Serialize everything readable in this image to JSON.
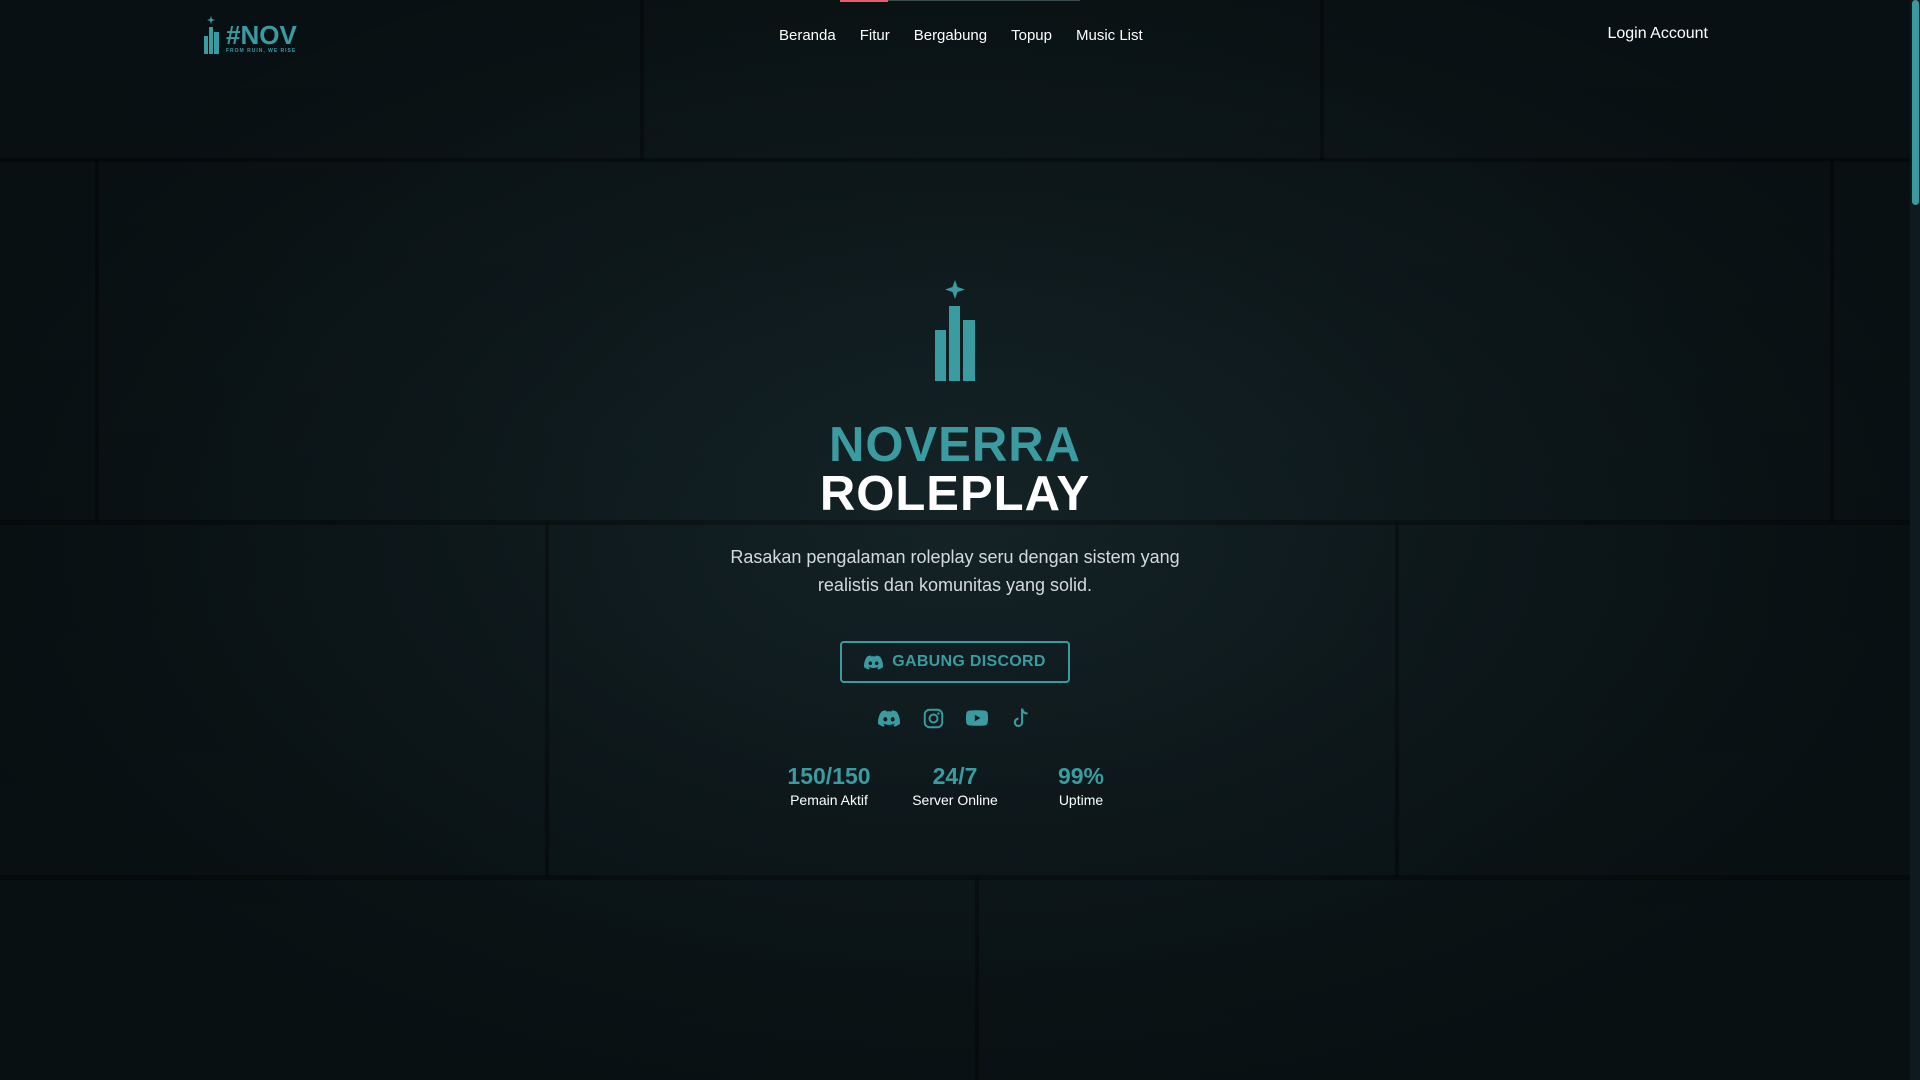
{
  "colors": {
    "accent": "#3a9ba1",
    "background": "#0b1417",
    "text": "#ffffff"
  },
  "header": {
    "logo": {
      "text": "#NOV",
      "tagline": "FROM RUIN, WE RISE",
      "icon": "building-star-icon"
    },
    "nav": [
      {
        "label": "Beranda"
      },
      {
        "label": "Fitur"
      },
      {
        "label": "Bergabung"
      },
      {
        "label": "Topup"
      },
      {
        "label": "Music List"
      }
    ],
    "login_label": "Login Account"
  },
  "hero": {
    "icon": "building-star-icon",
    "title_line1": "NOVERRA",
    "title_line2": "ROLEPLAY",
    "description": "Rasakan pengalaman roleplay seru dengan sistem yang realistis dan komunitas yang solid.",
    "cta": {
      "label": "GABUNG DISCORD",
      "icon": "discord-icon"
    },
    "socials": [
      {
        "icon": "discord-icon"
      },
      {
        "icon": "instagram-icon"
      },
      {
        "icon": "youtube-icon"
      },
      {
        "icon": "tiktok-icon"
      }
    ],
    "stats": [
      {
        "value": "150/150",
        "label": "Pemain Aktif"
      },
      {
        "value": "24/7",
        "label": "Server Online"
      },
      {
        "value": "99%",
        "label": "Uptime"
      }
    ]
  }
}
